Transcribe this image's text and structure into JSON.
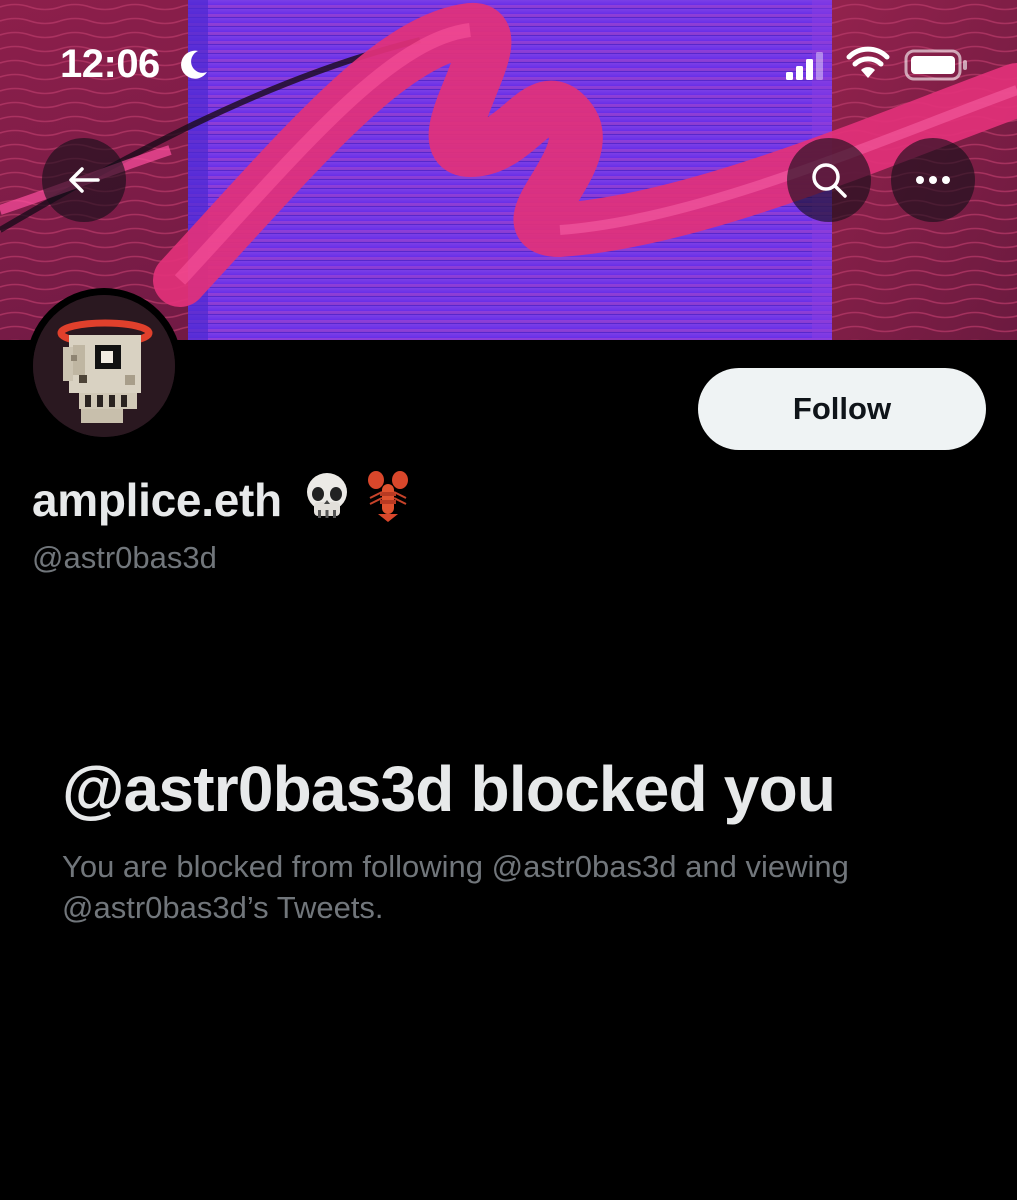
{
  "status_bar": {
    "time": "12:06"
  },
  "header": {
    "back_icon": "arrow-left-icon",
    "search_icon": "search-icon",
    "more_icon": "more-horizontal-icon"
  },
  "profile": {
    "display_name": "amplice.eth",
    "name_emojis": [
      "skull-emoji",
      "lobster-emoji"
    ],
    "handle": "@astr0bas3d",
    "follow_label": "Follow",
    "avatar": "pixel-skull-avatar"
  },
  "blocked": {
    "title": "@astr0bas3d blocked you",
    "description": "You are blocked from following @astr0bas3d and viewing @astr0bas3d’s Tweets."
  },
  "colors": {
    "background": "#000000",
    "text_primary": "#e7e9ea",
    "text_secondary": "#71767b",
    "follow_button_bg": "#eff3f4",
    "banner_magenta": "#e2317a",
    "banner_violet": "#6a2bf0"
  }
}
